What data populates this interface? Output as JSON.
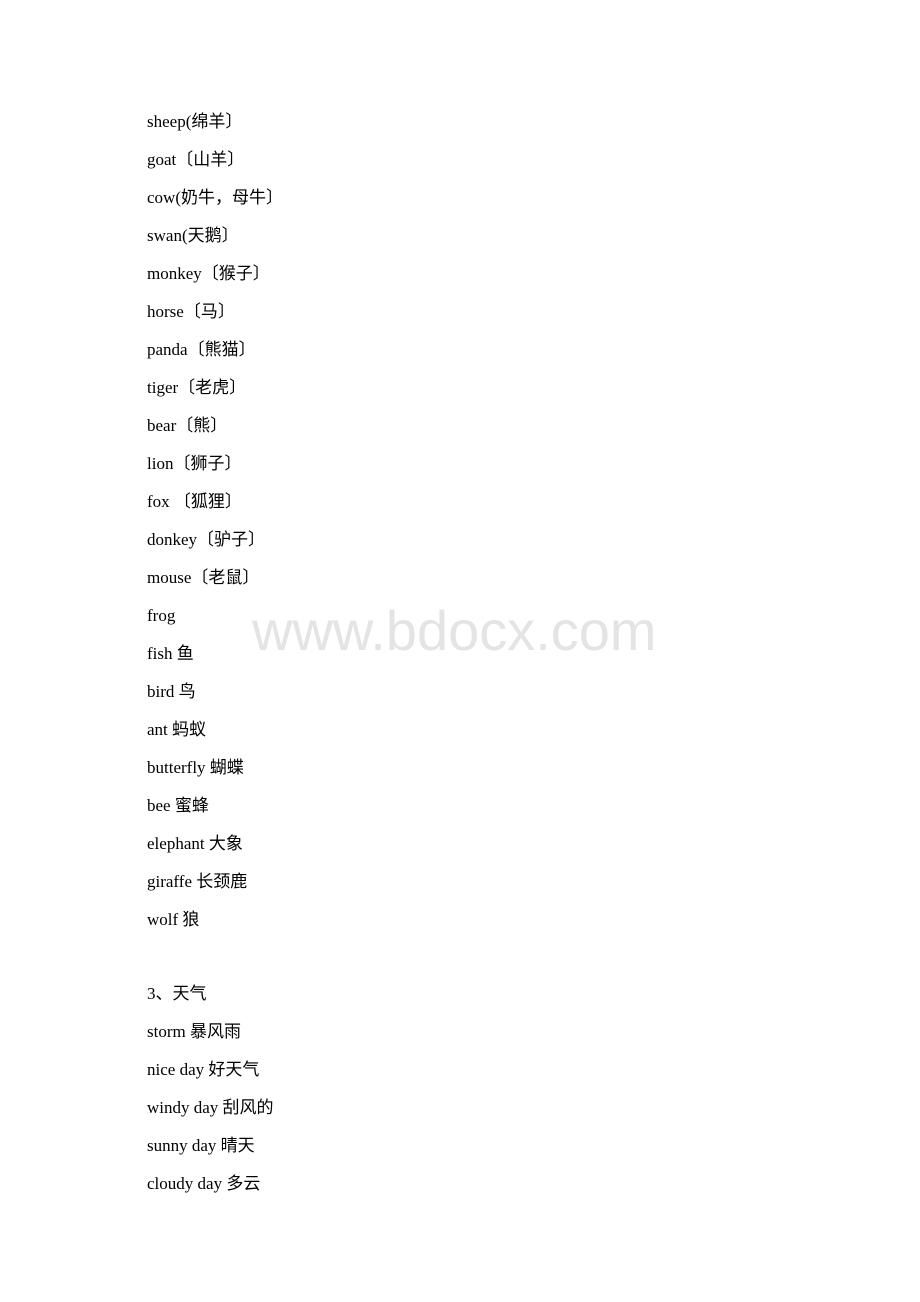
{
  "document": {
    "animals": [
      "sheep(绵羊〕",
      "goat〔山羊〕",
      "cow(奶牛，母牛〕",
      "swan(天鹅〕",
      "monkey〔猴子〕",
      "horse〔马〕",
      "panda〔熊猫〕",
      "tiger〔老虎〕",
      "bear〔熊〕",
      "lion〔狮子〕",
      "fox 〔狐狸〕",
      "donkey〔驴子〕",
      "mouse〔老鼠〕",
      "frog",
      "fish 鱼",
      "bird 鸟",
      "ant 蚂蚁",
      "butterfly 蝴蝶",
      "bee 蜜蜂",
      "elephant 大象",
      "giraffe 长颈鹿",
      "wolf 狼"
    ],
    "weather_heading": "3、天气",
    "weather": [
      "storm 暴风雨",
      "nice day 好天气",
      "windy day 刮风的",
      "sunny day 晴天",
      "cloudy day 多云"
    ]
  },
  "watermark": {
    "text": "www.bdocx.com"
  }
}
